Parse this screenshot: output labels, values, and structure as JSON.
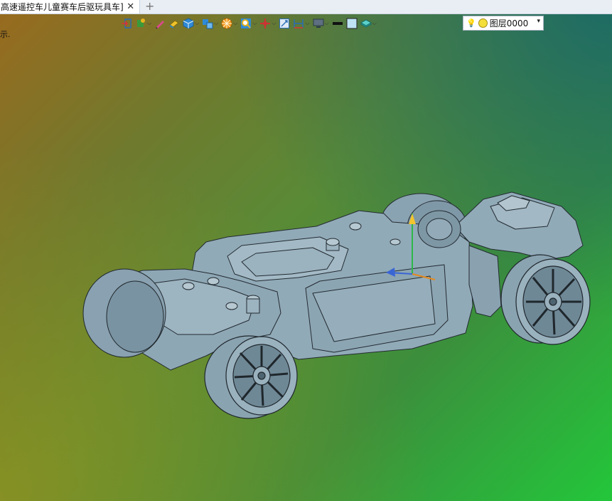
{
  "tabbar": {
    "active_tab_title": "高速遥控车儿童赛车后驱玩具车]",
    "close_glyph": "✕",
    "add_glyph": "+"
  },
  "status": {
    "fragment": "示."
  },
  "toolbar": {
    "items": [
      {
        "name": "exit-icon"
      },
      {
        "name": "paint-icon",
        "dropdown": true
      },
      {
        "name": "pencil-icon"
      },
      {
        "name": "eraser-icon"
      },
      {
        "name": "cube-icon",
        "dropdown": true
      },
      {
        "name": "blocks-icon",
        "dropdown": true
      },
      {
        "name": "palette-icon",
        "dropdown": true
      },
      {
        "name": "zoom-icon",
        "dropdown": true
      },
      {
        "name": "move-icon",
        "dropdown": true
      },
      {
        "name": "fit-view-icon"
      },
      {
        "name": "dimension-icon",
        "dropdown": true
      },
      {
        "name": "monitor-icon",
        "dropdown": true
      },
      {
        "name": "line-icon"
      },
      {
        "name": "square-icon"
      },
      {
        "name": "layers-icon",
        "dropdown": true
      }
    ],
    "layer_selector": {
      "value": "图层0000"
    }
  },
  "colors": {
    "model_fill": "#8fa8b6",
    "model_stroke": "#222a30",
    "tab_bg": "#e9eef5"
  }
}
